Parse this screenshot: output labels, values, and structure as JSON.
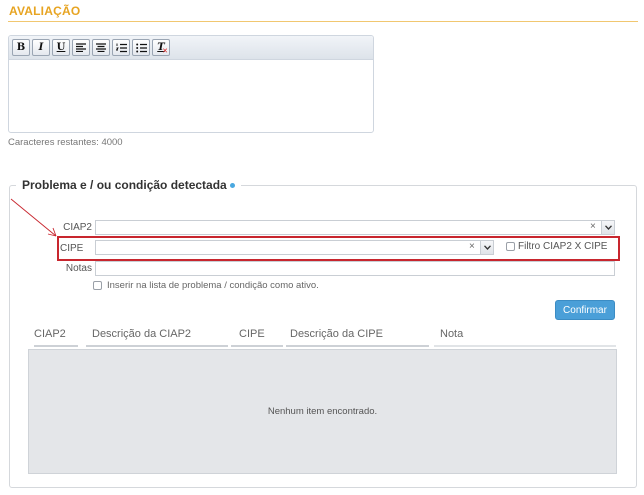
{
  "section": {
    "title": "AVALIAÇÃO"
  },
  "editor": {
    "toolbar": [
      {
        "name": "bold-button",
        "label": "B",
        "icon": "bold"
      },
      {
        "name": "italic-button",
        "label": "I",
        "icon": "italic"
      },
      {
        "name": "underline-button",
        "label": "U",
        "icon": "underline"
      },
      {
        "name": "align-left-button",
        "icon": "align-left-icon"
      },
      {
        "name": "align-center-button",
        "icon": "align-center-icon"
      },
      {
        "name": "ordered-list-button",
        "icon": "ordered-list-icon"
      },
      {
        "name": "unordered-list-button",
        "icon": "bullet-list-icon"
      },
      {
        "name": "clear-format-button",
        "label": "T",
        "icon": "clear-format-icon"
      }
    ],
    "value": "",
    "chars_remaining": "Caracteres restantes: 4000"
  },
  "problem": {
    "legend": "Problema e / ou condição detectada",
    "required_dot_color": "#4aa8e0",
    "ciap2": {
      "label": "CIAP2",
      "value": "",
      "clear": "×"
    },
    "cipe": {
      "label": "CIPE",
      "value": "",
      "clear": "×"
    },
    "filter": {
      "label": "Filtro CIAP2 X CIPE",
      "checked": false
    },
    "notas": {
      "label": "Notas",
      "value": ""
    },
    "insert_active": {
      "label": "Inserir na lista de problema / condição como ativo.",
      "checked": false
    },
    "confirm_label": "Confirmar",
    "highlight_color": "#c8262e",
    "accent_color": "#4a9fd8"
  },
  "table": {
    "columns": [
      "CIAP2",
      "Descrição da CIAP2",
      "CIPE",
      "Descrição da CIPE",
      "Nota"
    ],
    "empty_message": "Nenhum item encontrado."
  }
}
